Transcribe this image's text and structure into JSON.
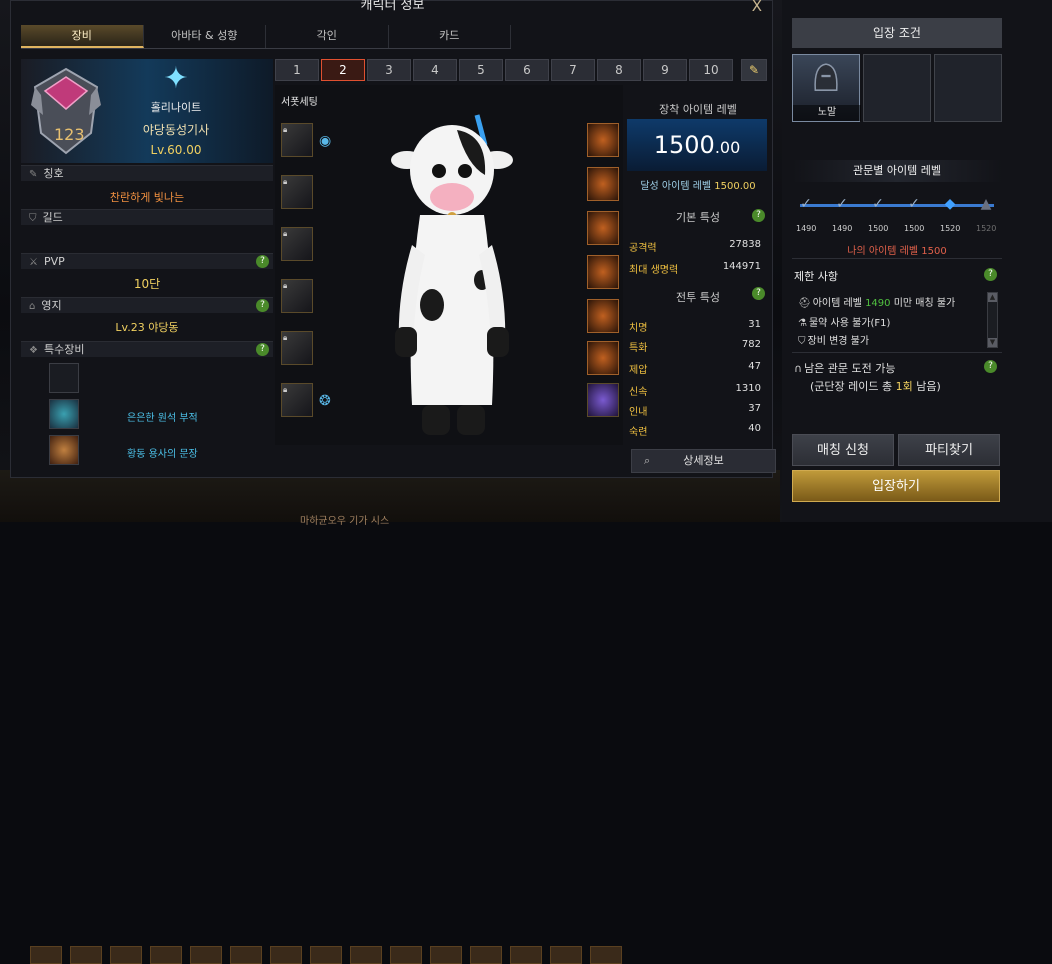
{
  "window": {
    "title": "캐릭터 정보",
    "close": "X"
  },
  "tabs": [
    {
      "label": "장비",
      "active": true
    },
    {
      "label": "아바타 & 성향"
    },
    {
      "label": "각인"
    },
    {
      "label": "카드"
    }
  ],
  "profile": {
    "rank_number": "123",
    "class_name": "홀리나이트",
    "title": "야당동성기사",
    "level": "Lv.60.00"
  },
  "sections": {
    "title_label": "칭호",
    "title_value": "찬란하게 빛나는",
    "guild_label": "길드",
    "guild_value": "",
    "pvp_label": "PVP",
    "pvp_value": "10단",
    "estate_label": "영지",
    "estate_value": "Lv.23 야당동",
    "special_label": "특수장비",
    "special_items": [
      {
        "label": "은은한 원석 부적"
      },
      {
        "label": "황동 용사의 문장"
      }
    ]
  },
  "presets": {
    "labels": [
      "1",
      "2",
      "3",
      "4",
      "5",
      "6",
      "7",
      "8",
      "9",
      "10"
    ],
    "active": "2"
  },
  "character": {
    "preset_label": "서폿세팅"
  },
  "stats": {
    "item_level_header": "장착 아이템 레벨",
    "item_level_main": "1500",
    "item_level_decimal": ".00",
    "achieved_label": "달성 아이템 레벨",
    "achieved_value": "1500.00",
    "basic_header": "기본 특성",
    "basic": [
      {
        "k": "공격력",
        "v": "27838"
      },
      {
        "k": "최대 생명력",
        "v": "144971"
      }
    ],
    "combat_header": "전투 특성",
    "combat": [
      {
        "k": "치명",
        "v": "31"
      },
      {
        "k": "특화",
        "v": "782"
      },
      {
        "k": "제압",
        "v": "47"
      },
      {
        "k": "신속",
        "v": "1310"
      },
      {
        "k": "인내",
        "v": "37"
      },
      {
        "k": "숙련",
        "v": "40"
      }
    ],
    "detail_button": "상세정보"
  },
  "entry": {
    "header": "입장 조건",
    "difficulty_selected": "노말",
    "gate_header": "관문별 아이템 레벨",
    "gate_levels": [
      "1490",
      "1490",
      "1500",
      "1500",
      "1520",
      "1520"
    ],
    "my_level": "나의 아이템 레벨 1500",
    "restriction_label": "제한 사항",
    "restriction_1_pre": "아이템 레벨 ",
    "restriction_1_val": "1490",
    "restriction_1_post": " 미만 매칭 불가",
    "restriction_2": "물약 사용 불가(F1)",
    "restriction_3": "장비 변경 불가",
    "remaining_1": "남은 관문 도전 가능",
    "remaining_2_pre": "(군단장 레이드 총 ",
    "remaining_2_val": "1회",
    "remaining_2_post": " 남음)",
    "match_button": "매칭 신청",
    "party_button": "파티찾기",
    "enter_button": "입장하기"
  },
  "background_text": "마하균오우 기가 시스"
}
